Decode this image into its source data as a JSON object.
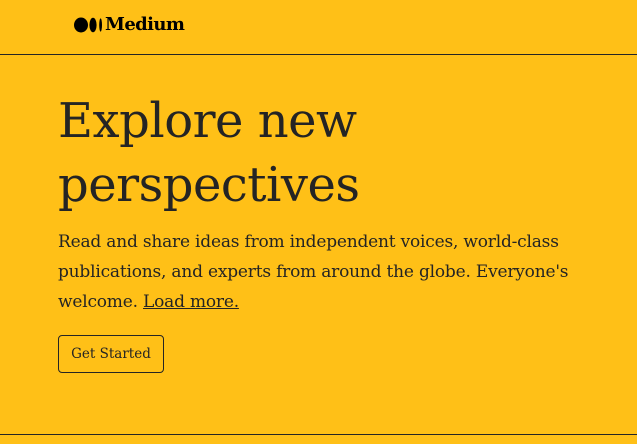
{
  "brand": {
    "name": "Medium",
    "logo_icon": "medium-logo-icon"
  },
  "hero": {
    "headline_line1": "Explore new",
    "headline_line2": "perspectives",
    "lead_text": "Read and share ideas from independent voices, world-class publications, and experts from around the globe. Everyone's welcome.",
    "load_more_label": "Load more."
  },
  "cta": {
    "label": "Get Started"
  },
  "colors": {
    "background": "#ffc017",
    "text": "#242424",
    "logo": "#000000"
  }
}
